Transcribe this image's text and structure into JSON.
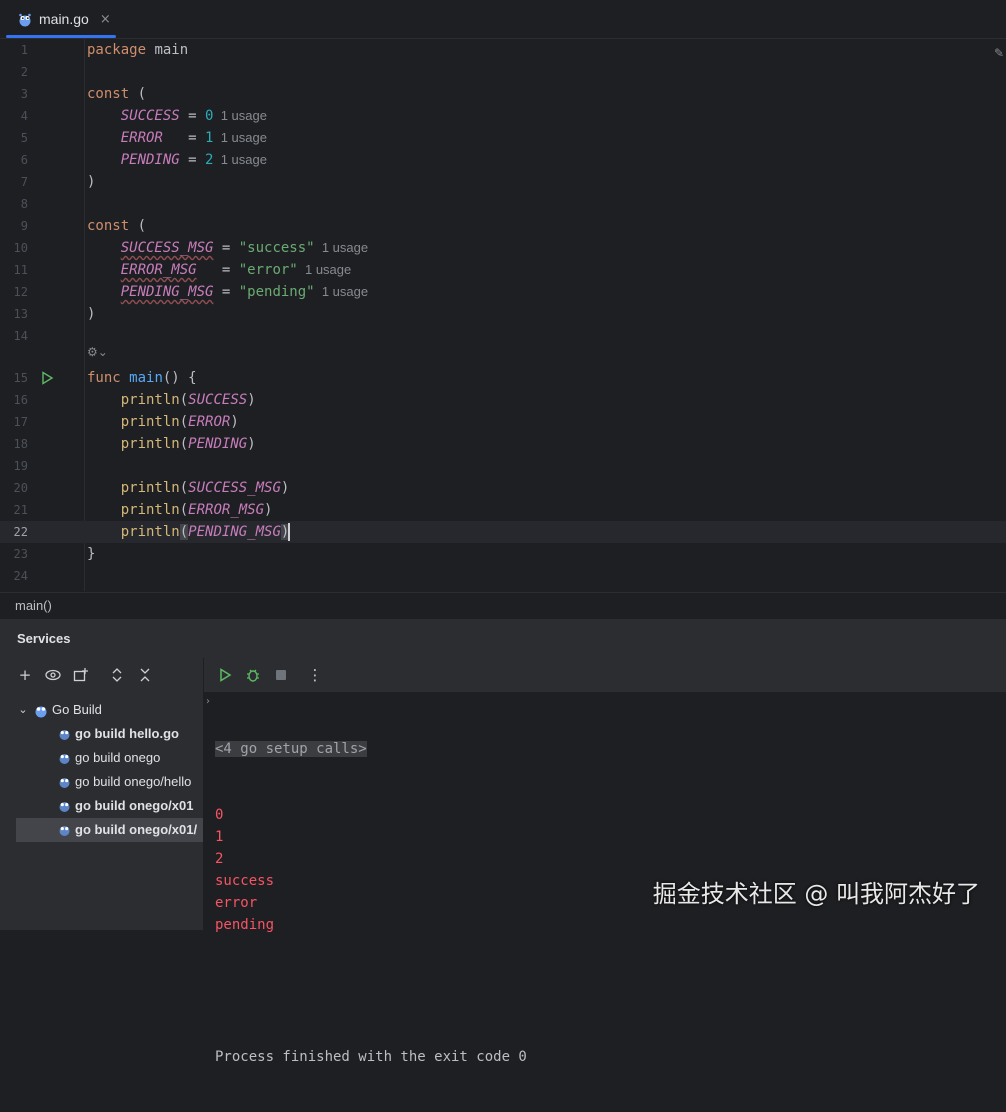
{
  "tab": {
    "label": "main.go",
    "close": "×"
  },
  "editor": {
    "lines": [
      {
        "n": "1",
        "tokens": [
          [
            "kw",
            "package "
          ],
          [
            "plain",
            "main"
          ]
        ]
      },
      {
        "n": "2",
        "tokens": []
      },
      {
        "n": "3",
        "tokens": [
          [
            "kw",
            "const "
          ],
          [
            "plain",
            "("
          ]
        ]
      },
      {
        "n": "4",
        "tokens": [
          [
            "plain",
            "    "
          ],
          [
            "const",
            "SUCCESS"
          ],
          [
            "plain",
            " = "
          ],
          [
            "num",
            "0"
          ],
          [
            "hint",
            "  1 usage"
          ]
        ]
      },
      {
        "n": "5",
        "tokens": [
          [
            "plain",
            "    "
          ],
          [
            "const",
            "ERROR"
          ],
          [
            "plain",
            "   = "
          ],
          [
            "num",
            "1"
          ],
          [
            "hint",
            "  1 usage"
          ]
        ]
      },
      {
        "n": "6",
        "tokens": [
          [
            "plain",
            "    "
          ],
          [
            "const",
            "PENDING"
          ],
          [
            "plain",
            " = "
          ],
          [
            "num",
            "2"
          ],
          [
            "hint",
            "  1 usage"
          ]
        ]
      },
      {
        "n": "7",
        "tokens": [
          [
            "plain",
            ")"
          ]
        ]
      },
      {
        "n": "8",
        "tokens": []
      },
      {
        "n": "9",
        "tokens": [
          [
            "kw",
            "const "
          ],
          [
            "plain",
            "("
          ]
        ]
      },
      {
        "n": "10",
        "tokens": [
          [
            "plain",
            "    "
          ],
          [
            "const-u",
            "SUCCESS_MSG"
          ],
          [
            "plain",
            " = "
          ],
          [
            "str",
            "\"success\""
          ],
          [
            "hint",
            "  1 usage"
          ]
        ]
      },
      {
        "n": "11",
        "tokens": [
          [
            "plain",
            "    "
          ],
          [
            "const-u",
            "ERROR_MSG"
          ],
          [
            "plain",
            "   = "
          ],
          [
            "str",
            "\"error\""
          ],
          [
            "hint",
            "  1 usage"
          ]
        ]
      },
      {
        "n": "12",
        "tokens": [
          [
            "plain",
            "    "
          ],
          [
            "const-u",
            "PENDING_MSG"
          ],
          [
            "plain",
            " = "
          ],
          [
            "str",
            "\"pending\""
          ],
          [
            "hint",
            "  1 usage"
          ]
        ]
      },
      {
        "n": "13",
        "tokens": [
          [
            "plain",
            ")"
          ]
        ]
      },
      {
        "n": "14",
        "tokens": []
      },
      {
        "n": "15",
        "tokens": [
          [
            "kw",
            "func "
          ],
          [
            "fn",
            "main"
          ],
          [
            "plain",
            "() {"
          ]
        ]
      },
      {
        "n": "16",
        "tokens": [
          [
            "plain",
            "    "
          ],
          [
            "builtin",
            "println"
          ],
          [
            "plain",
            "("
          ],
          [
            "const",
            "SUCCESS"
          ],
          [
            "plain",
            ")"
          ]
        ]
      },
      {
        "n": "17",
        "tokens": [
          [
            "plain",
            "    "
          ],
          [
            "builtin",
            "println"
          ],
          [
            "plain",
            "("
          ],
          [
            "const",
            "ERROR"
          ],
          [
            "plain",
            ")"
          ]
        ]
      },
      {
        "n": "18",
        "tokens": [
          [
            "plain",
            "    "
          ],
          [
            "builtin",
            "println"
          ],
          [
            "plain",
            "("
          ],
          [
            "const",
            "PENDING"
          ],
          [
            "plain",
            ")"
          ]
        ]
      },
      {
        "n": "19",
        "tokens": []
      },
      {
        "n": "20",
        "tokens": [
          [
            "plain",
            "    "
          ],
          [
            "builtin",
            "println"
          ],
          [
            "plain",
            "("
          ],
          [
            "const",
            "SUCCESS_MSG"
          ],
          [
            "plain",
            ")"
          ]
        ]
      },
      {
        "n": "21",
        "tokens": [
          [
            "plain",
            "    "
          ],
          [
            "builtin",
            "println"
          ],
          [
            "plain",
            "("
          ],
          [
            "const",
            "ERROR_MSG"
          ],
          [
            "plain",
            ")"
          ]
        ]
      },
      {
        "n": "22",
        "tokens": [
          [
            "plain",
            "    "
          ],
          [
            "builtin",
            "println"
          ],
          [
            "hl",
            "("
          ],
          [
            "const",
            "PENDING_MSG"
          ],
          [
            "hl",
            ")"
          ],
          [
            "cursor",
            ""
          ]
        ]
      },
      {
        "n": "23",
        "tokens": [
          [
            "plain",
            "}"
          ]
        ]
      },
      {
        "n": "24",
        "tokens": []
      }
    ],
    "current_line": "22",
    "inlay_label": "⚙⌄"
  },
  "breadcrumb": "main()",
  "services": {
    "title": "Services",
    "left_toolbar_icons": [
      "add-icon",
      "eye-icon",
      "new-tab-icon",
      "expand-icon",
      "collapse-icon"
    ],
    "tree": {
      "root": "Go Build",
      "items": [
        {
          "label": "go build hello.go",
          "bold": true
        },
        {
          "label": "go build onego",
          "bold": false
        },
        {
          "label": "go build onego/hello",
          "bold": false
        },
        {
          "label": "go build onego/x01",
          "bold": true
        },
        {
          "label": "go build onego/x01/",
          "bold": true,
          "selected": true
        }
      ]
    },
    "right_toolbar_icons": [
      "run-icon",
      "debug-icon",
      "stop-icon",
      "more-icon"
    ],
    "console": {
      "setup_calls": "<4 go setup calls>",
      "output": [
        "0",
        "1",
        "2",
        "success",
        "error",
        "pending"
      ],
      "blank": "",
      "exit": "Process finished with the exit code 0"
    }
  },
  "watermark": "掘金技术社区 @ 叫我阿杰好了",
  "colors": {
    "accent": "#3574f0",
    "keyword": "#cf8e6d",
    "constant": "#c77dbb",
    "number": "#2aacb8",
    "string": "#6aab73",
    "builtin": "#d5b778",
    "output": "#f75464"
  }
}
